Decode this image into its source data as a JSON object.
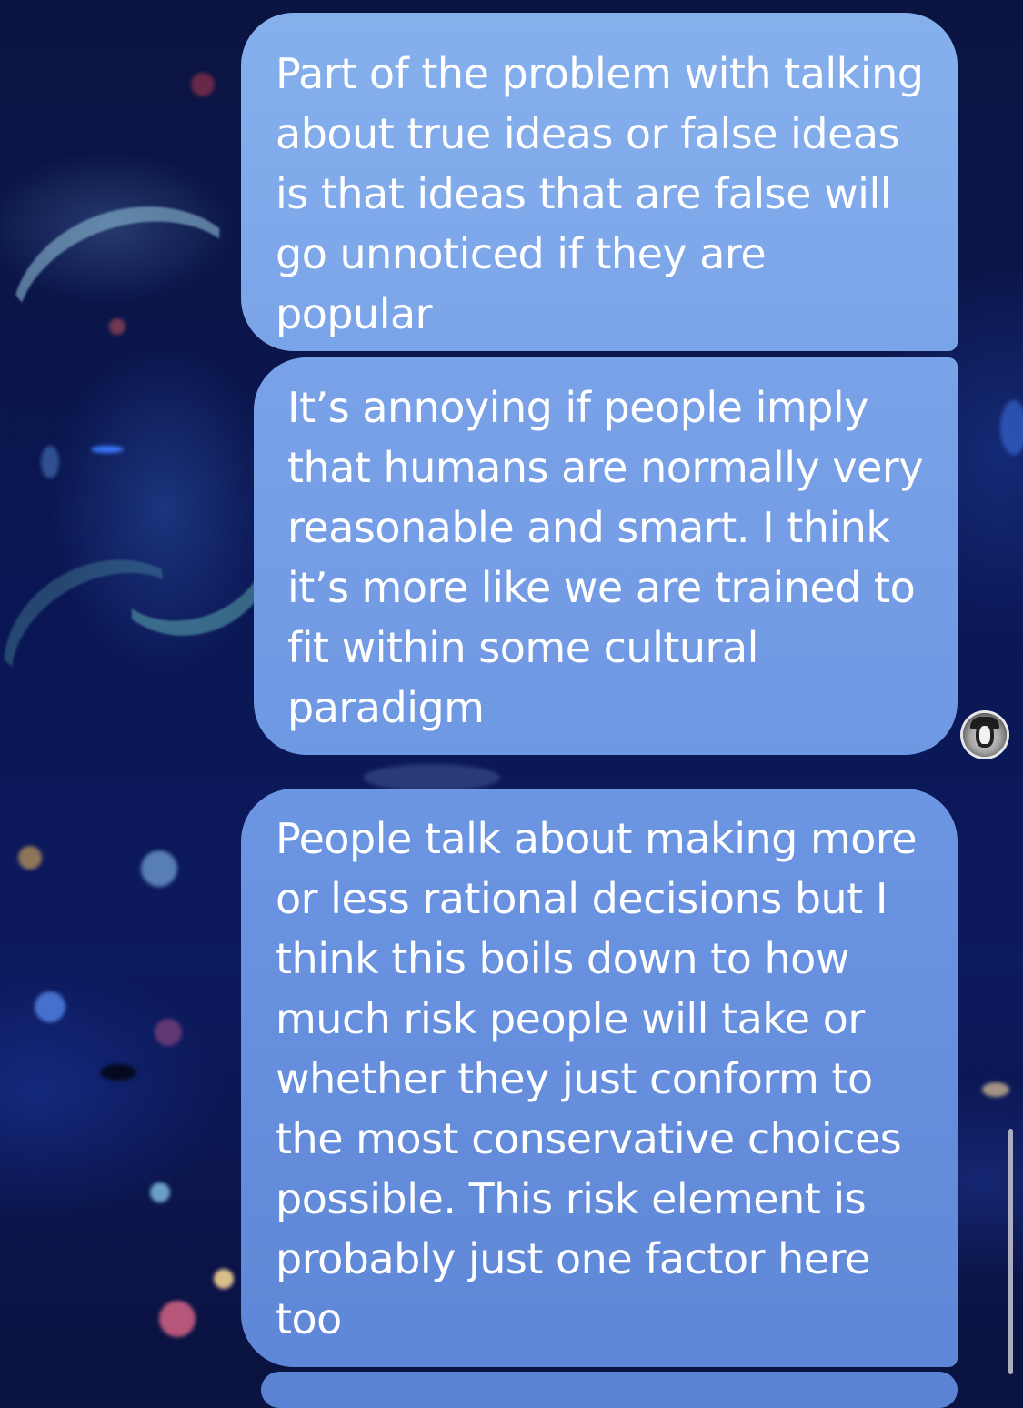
{
  "conversation": {
    "messages": [
      {
        "sender": "self",
        "text": "Part of the problem with talking about true ideas or false ideas is that ideas that are false will go unnoticed if they are popular"
      },
      {
        "sender": "self",
        "text": "It’s annoying if people imply that humans are normally very reasonable and smart. I think it’s more like we are trained to fit within some cultural paradigm"
      },
      {
        "sender": "self",
        "text": "People talk about making more or less rational decisions but I think this boils down to how much risk people will take or whether they just conform to the most conservative choices possible. This risk element is probably just one factor here too"
      }
    ],
    "avatar_icon": "person-avatar-icon"
  },
  "colors": {
    "background_dark": "#0a1652",
    "bubble_top": "#86b0ec",
    "bubble_bottom": "#5f87d7",
    "text": "#ffffff"
  }
}
